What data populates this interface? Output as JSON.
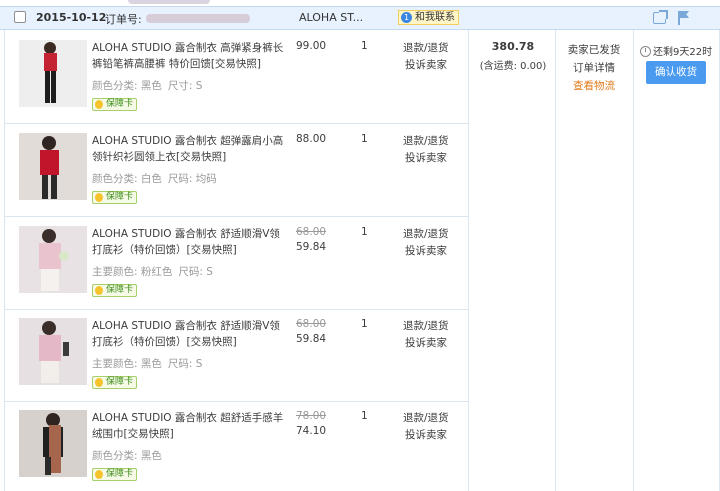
{
  "order": {
    "date": "2015-10-12",
    "order_no_label": "订单号:",
    "shop": "ALOHA ST...",
    "contact_badge": "1",
    "contact_label": "和我联系",
    "total": "380.78",
    "shipping_note": "(含运费: 0.00)",
    "status": "卖家已发货",
    "detail_link": "订单详情",
    "logistics_link": "查看物流",
    "countdown": "还剩9天22时",
    "confirm_button": "确认收货"
  },
  "item_actions": {
    "refund": "退款/退货",
    "complain": "投诉卖家"
  },
  "items": [
    {
      "title": "ALOHA STUDIO 露合制衣 高弹紧身裤长裤铅笔裤高腰裤 特价回馈[交易快照]",
      "spec1": "颜色分类: 黑色",
      "spec2": "尺寸: S",
      "badge": "保障卡",
      "price_old": "",
      "price": "99.00",
      "qty": "1"
    },
    {
      "title": "ALOHA STUDIO 露合制衣 超弹露肩小高领针织衫圆领上衣[交易快照]",
      "spec1": "颜色分类: 白色",
      "spec2": "尺码: 均码",
      "badge": "保障卡",
      "price_old": "",
      "price": "88.00",
      "qty": "1"
    },
    {
      "title": "ALOHA STUDIO 露合制衣 舒适顺滑V领打底衫（特价回馈）[交易快照]",
      "spec1": "主要颜色: 粉红色",
      "spec2": "尺码: S",
      "badge": "保障卡",
      "price_old": "68.00",
      "price": "59.84",
      "qty": "1"
    },
    {
      "title": "ALOHA STUDIO 露合制衣 舒适顺滑V领打底衫（特价回馈）[交易快照]",
      "spec1": "主要颜色: 黑色",
      "spec2": "尺码: S",
      "badge": "保障卡",
      "price_old": "68.00",
      "price": "59.84",
      "qty": "1"
    },
    {
      "title": "ALOHA STUDIO 露合制衣 超舒适手感羊绒围巾[交易快照]",
      "spec1": "颜色分类: 黑色",
      "spec2": "",
      "badge": "保障卡",
      "price_old": "78.00",
      "price": "74.10",
      "qty": "1"
    }
  ]
}
